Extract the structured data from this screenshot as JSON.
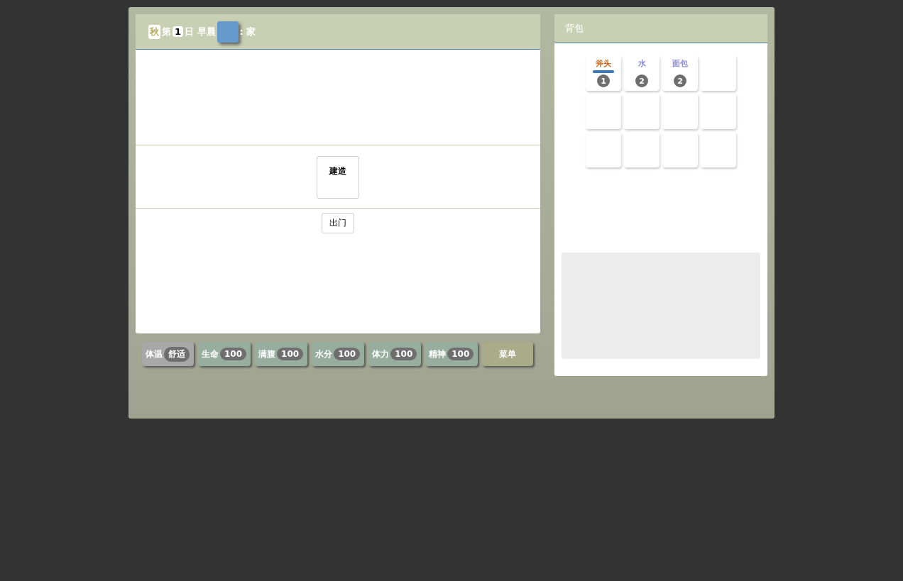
{
  "header": {
    "season": "秋",
    "day_prefix": "第",
    "day": "1",
    "day_suffix": "日 早晨",
    "location": ": 家"
  },
  "actions": [
    {
      "label": "建造"
    }
  ],
  "go_out_button": "出门",
  "stats": [
    {
      "kind": "temperature",
      "label": "体温",
      "value": "舒适"
    },
    {
      "kind": "vital",
      "label": "生命",
      "value": "100"
    },
    {
      "kind": "vital",
      "label": "满腹",
      "value": "100"
    },
    {
      "kind": "vital",
      "label": "水分",
      "value": "100"
    },
    {
      "kind": "vital",
      "label": "体力",
      "value": "100"
    },
    {
      "kind": "vital",
      "label": "精神",
      "value": "100"
    }
  ],
  "menu_button": "菜单",
  "backpack": {
    "title": "背包",
    "slots": [
      {
        "kind": "item",
        "name": "斧头",
        "color": "#d2691e",
        "count": "1",
        "level": 1
      },
      {
        "kind": "item",
        "name": "水",
        "color": "#8a8ad0",
        "count": "2"
      },
      {
        "kind": "item",
        "name": "面包",
        "color": "#8a8ad0",
        "count": "2"
      },
      {
        "kind": "empty"
      },
      {
        "kind": "empty"
      },
      {
        "kind": "empty"
      },
      {
        "kind": "empty"
      },
      {
        "kind": "empty"
      },
      {
        "kind": "empty"
      },
      {
        "kind": "empty"
      },
      {
        "kind": "empty"
      },
      {
        "kind": "empty"
      }
    ]
  }
}
